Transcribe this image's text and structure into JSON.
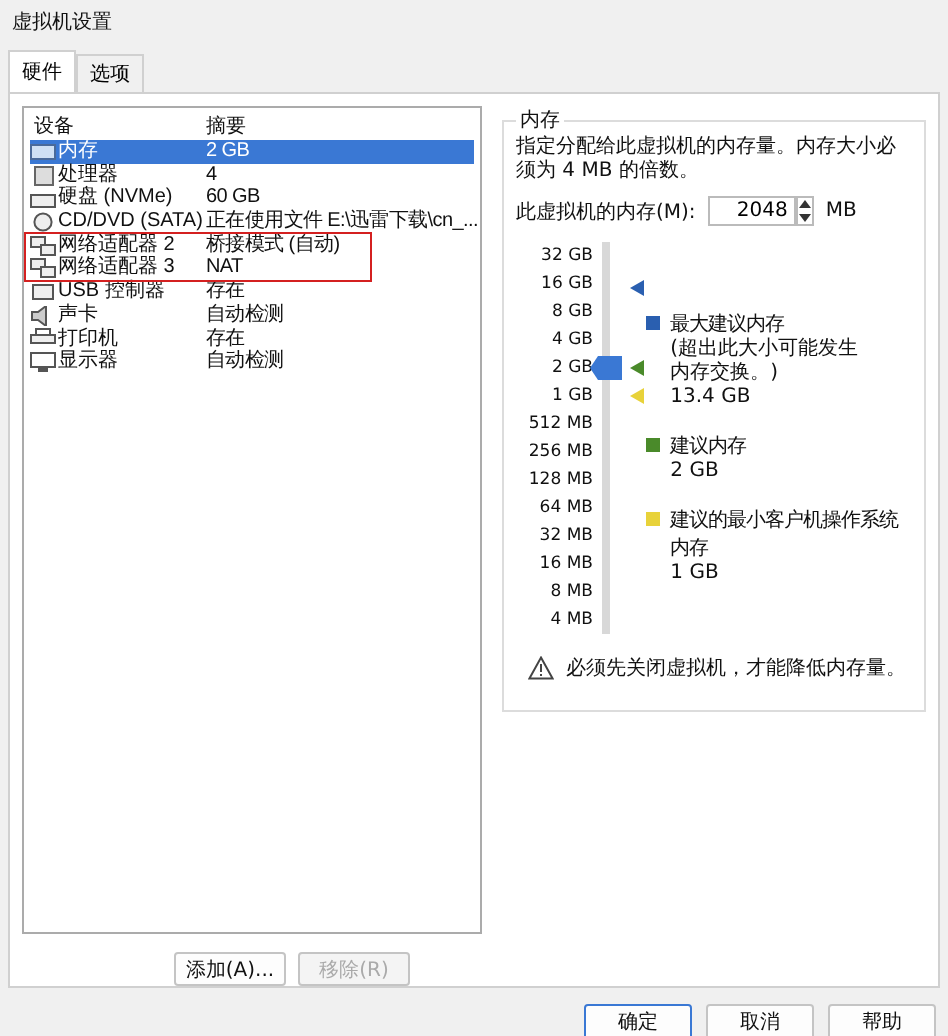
{
  "window": {
    "title": "虚拟机设置"
  },
  "tabs": [
    {
      "label": "硬件",
      "selected": true
    },
    {
      "label": "选项",
      "selected": false
    }
  ],
  "device_table": {
    "columns": [
      "设备",
      "摘要"
    ],
    "rows": [
      {
        "device": "内存",
        "summary": "2 GB",
        "selected": true,
        "highlighted": false
      },
      {
        "device": "处理器",
        "summary": "4",
        "selected": false,
        "highlighted": false
      },
      {
        "device": "硬盘 (NVMe)",
        "summary": "60 GB",
        "selected": false,
        "highlighted": false
      },
      {
        "device": "CD/DVD (SATA)",
        "summary": "正在使用文件 E:\\迅雷下载\\cn_...",
        "selected": false,
        "highlighted": false
      },
      {
        "device": "网络适配器 2",
        "summary": "桥接模式 (自动)",
        "selected": false,
        "highlighted": true
      },
      {
        "device": "网络适配器 3",
        "summary": "NAT",
        "selected": false,
        "highlighted": true
      },
      {
        "device": "USB 控制器",
        "summary": "存在",
        "selected": false,
        "highlighted": false
      },
      {
        "device": "声卡",
        "summary": "自动检测",
        "selected": false,
        "highlighted": false
      },
      {
        "device": "打印机",
        "summary": "存在",
        "selected": false,
        "highlighted": false
      },
      {
        "device": "显示器",
        "summary": "自动检测",
        "selected": false,
        "highlighted": false
      }
    ]
  },
  "list_buttons": [
    {
      "label": "添加(A)...",
      "disabled": false
    },
    {
      "label": "移除(R)",
      "disabled": true
    }
  ],
  "memory": {
    "title": "内存",
    "description": "指定分配给此虚拟机的内存量。内存大小必须为 4 MB 的倍数。",
    "field_label": "此虚拟机的内存(M):",
    "value": "2048",
    "unit": "MB",
    "scale": [
      "32 GB",
      "16 GB",
      "8 GB",
      "4 GB",
      "2 GB",
      "1 GB",
      "512 MB",
      "256 MB",
      "128 MB",
      "64 MB",
      "32 MB",
      "16 MB",
      "8 MB",
      "4 MB"
    ],
    "level": 0.692,
    "legend": [
      {
        "label": "最大建议内存",
        "note": "(超出此大小可能发生内存交换。)",
        "value": "13.4 GB",
        "color": "#2a5fb0"
      },
      {
        "label": "建议内存",
        "value": "2 GB",
        "color": "#4a8a2a"
      },
      {
        "label": "建议的最小客户机操作系统内存",
        "value": "1 GB",
        "color": "#e8d23a"
      }
    ],
    "markers": [
      {
        "color": "#2a5fb0",
        "level": 0.91
      },
      {
        "color": "#4a8a2a",
        "level": 0.692
      },
      {
        "color": "#e8d23a",
        "level": 0.615
      }
    ],
    "warning": "必须先关闭虚拟机，才能降低内存量。"
  },
  "dialog_buttons": [
    {
      "label": "确定",
      "default": true
    },
    {
      "label": "取消",
      "default": false
    },
    {
      "label": "帮助",
      "default": false
    }
  ]
}
